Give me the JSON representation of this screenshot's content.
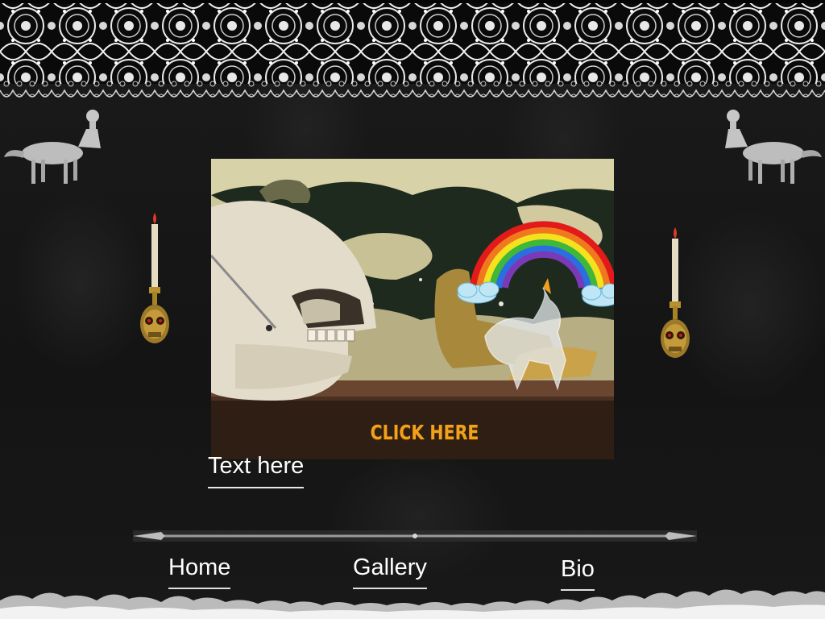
{
  "hero": {
    "cta_label": "CLICK HERE"
  },
  "content": {
    "text_here": "Text here"
  },
  "nav": {
    "items": [
      {
        "label": "Home"
      },
      {
        "label": "Gallery"
      },
      {
        "label": "Bio"
      }
    ]
  },
  "icons": {
    "lace": "lace-border-icon",
    "creature": "centaur-icon",
    "candle": "skull-candle-icon",
    "divider": "ornamental-divider-icon"
  },
  "colors": {
    "cta": "#f2a11a",
    "text": "#ffffff",
    "background": "#141414"
  }
}
